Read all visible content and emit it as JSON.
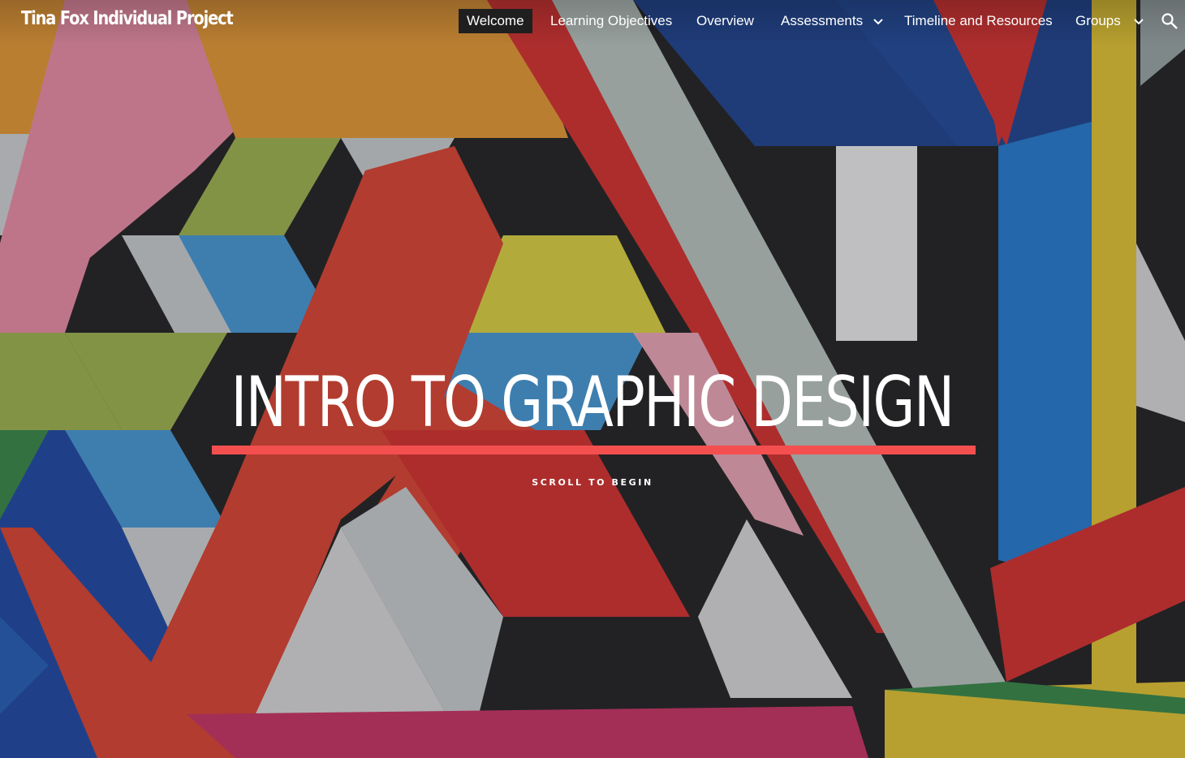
{
  "site": {
    "title": "Tina Fox Individual Project"
  },
  "nav": {
    "items": [
      {
        "label": "Welcome",
        "active": true
      },
      {
        "label": "Learning Objectives"
      },
      {
        "label": "Overview"
      },
      {
        "label": "Assessments",
        "has_dropdown": true
      },
      {
        "label": "Timeline and Resources"
      },
      {
        "label": "Groups",
        "has_dropdown": true
      }
    ],
    "search_icon": "search-icon"
  },
  "hero": {
    "title": "INTRO TO GRAPHIC DESIGN",
    "subtitle": "SCROLL TO BEGIN",
    "accent_color": "#f44f4f"
  }
}
